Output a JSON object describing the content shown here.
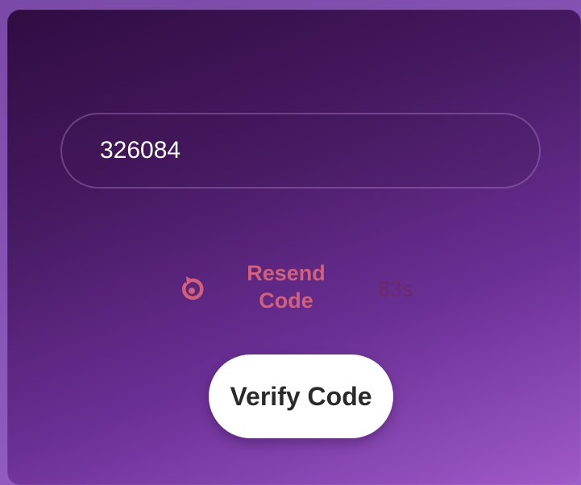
{
  "form": {
    "code_value": "326084"
  },
  "resend": {
    "icon": "refresh-icon",
    "label": "Resend Code",
    "timer": "83s"
  },
  "verify_button": {
    "label": "Verify Code"
  },
  "colors": {
    "accent": "#d35f78",
    "timer": "#6e2a62",
    "card_dark": "#300c42",
    "card_light": "#a05ac9"
  }
}
